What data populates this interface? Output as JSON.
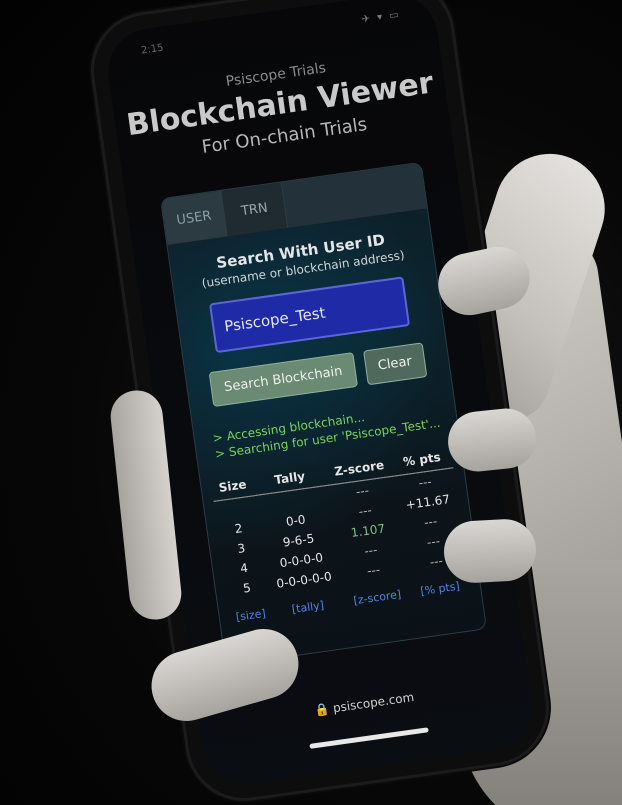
{
  "status_bar": {
    "time": "2:15",
    "icons": "✈ ▾ ▭"
  },
  "header": {
    "kicker": "Psiscope Trials",
    "title": "Blockchain Viewer",
    "subtitle": "For On-chain Trials"
  },
  "tabs": [
    {
      "label": "USER",
      "active": true
    },
    {
      "label": "TRN",
      "active": false
    }
  ],
  "search": {
    "title": "Search With User ID",
    "hint": "(username or blockchain address)",
    "value": "Psiscope_Test",
    "placeholder": "",
    "search_button": "Search Blockchain",
    "clear_button": "Clear"
  },
  "console": [
    {
      "prefix": ">",
      "text": "Accessing blockchain..."
    },
    {
      "prefix": ">",
      "text": "Searching for user 'Psiscope_Test'..."
    }
  ],
  "results": {
    "headers": [
      "Size",
      "Tally",
      "Z-score",
      "% pts"
    ],
    "rows": [
      [
        "",
        "",
        "---",
        "---"
      ],
      [
        "2",
        "0-0",
        "---",
        "+11.67"
      ],
      [
        "3",
        "9-6-5",
        "1.107",
        "---"
      ],
      [
        "4",
        "0-0-0-0",
        "---",
        "---"
      ],
      [
        "5",
        "0-0-0-0-0",
        "---",
        "---"
      ]
    ],
    "sort_links": [
      "[size]",
      "[tally]",
      "[z-score]",
      "[% pts]"
    ]
  },
  "url": "🔒 psiscope.com",
  "colors": {
    "input_bg": "#1e2aa6",
    "button_bg": "#6a8a74",
    "console_text": "#7ad35f",
    "link": "#4f86e8"
  }
}
